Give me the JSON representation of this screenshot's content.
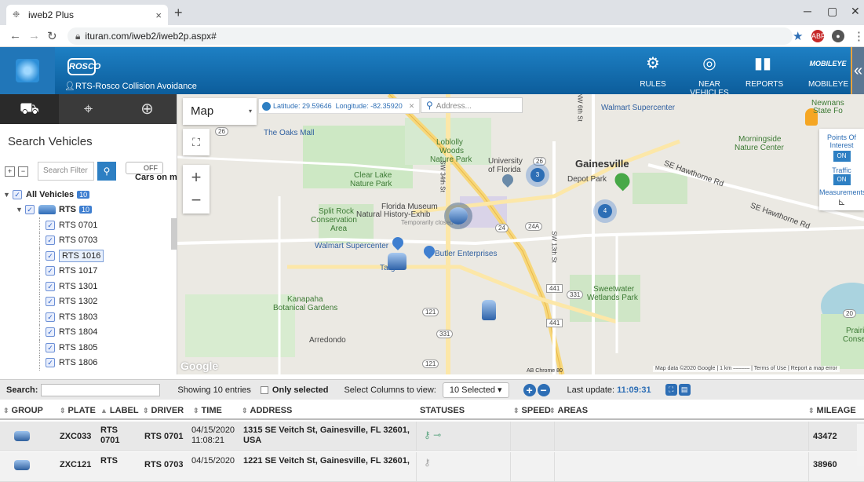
{
  "browser": {
    "tab_title": "iweb2 Plus",
    "url": "ituran.com/iweb2/iweb2p.aspx#",
    "new_tab": "+",
    "close_tab": "×"
  },
  "header": {
    "brand": "ROSCO",
    "subtitle": "RTS-Rosco Collision Avoidance",
    "nav": [
      {
        "label": "RULES",
        "icon": "rules-icon"
      },
      {
        "label": "NEAR VEHICLES",
        "icon": "near-vehicles-icon"
      },
      {
        "label": "REPORTS",
        "icon": "reports-icon"
      },
      {
        "label": "MOBILEYE",
        "icon": "mobileye-icon",
        "logo": "MOBILEYE"
      }
    ]
  },
  "sidebar": {
    "heading": "Search Vehicles",
    "filter_placeholder": "Search Filter",
    "toggle": "OFF",
    "cars_on_map": "Cars on map",
    "all_vehicles": {
      "label": "All Vehicles",
      "count": "10"
    },
    "group": {
      "label": "RTS",
      "count": "10"
    },
    "vehicles": [
      "RTS 0701",
      "RTS 0703",
      "RTS 1016",
      "RTS 1017",
      "RTS 1301",
      "RTS 1302",
      "RTS 1803",
      "RTS 1804",
      "RTS 1805",
      "RTS 1806"
    ],
    "selected_vehicle": "RTS 1016"
  },
  "map": {
    "type_label": "Map",
    "latitude_label": "Latitude:",
    "latitude": "29.59646",
    "longitude_label": "Longitude:",
    "longitude": "-82.35920",
    "address_placeholder": "Address...",
    "poi": {
      "title": "Points Of Interest",
      "poi_state": "ON",
      "traffic": "Traffic",
      "traffic_state": "ON",
      "measurements": "Measurements"
    },
    "labels": {
      "oaks_mall": "The Oaks Mall",
      "loblolly": "Loblolly",
      "woods": "Woods",
      "nature_park": "Nature Park",
      "university": "University",
      "of_florida": "of Florida",
      "gainesville": "Gainesville",
      "walmart1": "Walmart Supercenter",
      "newnans": "Newnans",
      "state_fo": "State Fo",
      "morningside": "Morningside",
      "nature_center": "Nature Center",
      "clear_lake": "Clear Lake",
      "clear_lake2": "Nature Park",
      "depot_park": "Depot Park",
      "hawthorne": "SE Hawthorne Rd",
      "hawthorne2": "SE Hawthorne Rd",
      "split_rock": "Split Rock",
      "conservation": "Conservation",
      "area": "Area",
      "museum": "Florida Museum",
      "natural_history": "Natural History-Exhib",
      "temp_closed": "Temporarily closed",
      "walmart2": "Walmart Supercenter",
      "butler": "Butler Enterprises",
      "target": "Target",
      "kanapaha": "Kanapaha",
      "botanical": "Botanical Gardens",
      "sweetwater": "Sweetwater",
      "wetlands": "Wetlands Park",
      "arredondo": "Arredondo",
      "prairie": "Prairi",
      "conse": "Conse",
      "sw34": "SW 34th St",
      "sw13": "SW 13th St",
      "nw6": "NW 6th St",
      "r26": "26",
      "r24": "24",
      "r24a": "24A",
      "r441": "441",
      "r331": "331",
      "r121": "121",
      "r20": "20"
    },
    "clusters": [
      "3",
      "4"
    ],
    "attribution": "Map data ©2020 Google  |  1 km ⎯⎯⎯⎯⎯⎯  |  Terms of Use  |  Report a map error",
    "google": "Google",
    "ab_chrome": "AB Chrome 80"
  },
  "toolbar": {
    "search_label": "Search:",
    "showing": "Showing 10 entries",
    "only_selected": "Only selected",
    "select_columns": "Select Columns to view:",
    "columns_value": "10 Selected ▾",
    "last_update_label": "Last update:",
    "last_update": "11:09:31"
  },
  "table": {
    "headers": [
      "GROUP",
      "PLATE",
      "LABEL",
      "DRIVER",
      "TIME",
      "ADDRESS",
      "STATUSES",
      "SPEED",
      "AREAS",
      "MILEAGE"
    ],
    "rows": [
      {
        "plate": "ZXC033",
        "label1": "RTS",
        "label2": "0701",
        "driver": "RTS 0701",
        "date": "04/15/2020",
        "time": "11:08:21",
        "address1": "1315 SE Veitch St, Gainesville, FL 32601,",
        "address2": "USA",
        "mileage": "43472"
      },
      {
        "plate": "ZXC121",
        "label1": "RTS",
        "label2": "",
        "driver": "RTS 0703",
        "date": "04/15/2020",
        "time": "",
        "address1": "1221 SE Veitch St, Gainesville, FL 32601,",
        "address2": "",
        "mileage": "38960"
      }
    ]
  }
}
